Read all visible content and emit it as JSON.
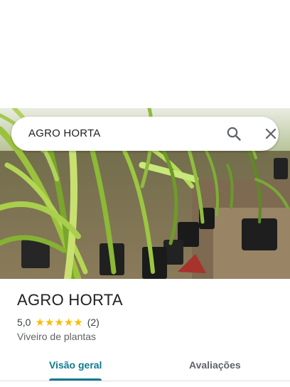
{
  "search": {
    "query": "AGRO HORTA"
  },
  "icons": {
    "search": "search-icon",
    "close": "close-icon"
  },
  "place": {
    "name": "AGRO HORTA",
    "rating": "5,0",
    "stars": 5,
    "review_count": "(2)",
    "category": "Viveiro de plantas"
  },
  "tabs": [
    {
      "label": "Visão geral",
      "selected": true
    },
    {
      "label": "Avaliações",
      "selected": false
    }
  ],
  "colors": {
    "accent": "#0d7a8c",
    "star": "#fbbc04"
  }
}
